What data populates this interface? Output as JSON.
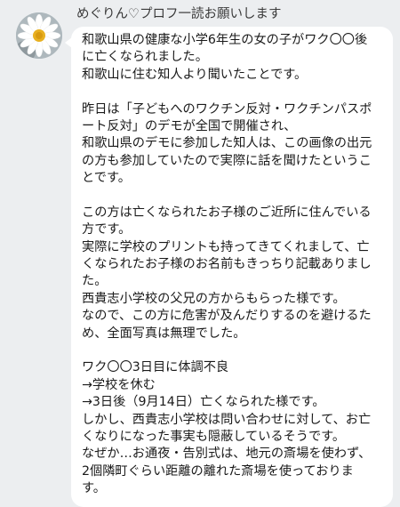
{
  "chat": {
    "sender_name": "めぐりん♡プロフ一読お願いします",
    "avatar_icon": "daisy-flower-avatar",
    "message_lines": [
      "和歌山県の健康な小学6年生の女の子がワク〇〇後",
      "に亡くなられました。",
      "和歌山に住む知人より聞いたことです。",
      "",
      "昨日は「子どもへのワクチン反対・ワクチンパスポ",
      "ート反対」のデモが全国で開催され、",
      "和歌山県のデモに参加した知人は、この画像の出元",
      "の方も参加していたので実際に話を聞けたというこ",
      "とです。",
      "",
      "この方は亡くなられたお子様のご近所に住んでいる",
      "方です。",
      "実際に学校のプリントも持ってきてくれまして、亡",
      "くなられたお子様のお名前もきっちり記載ありまし",
      "た。",
      "西貴志小学校の父兄の方からもらった様です。",
      "なので、この方に危害が及んだりするのを避けるた",
      "め、全面写真は無理でした。",
      "",
      "ワク〇〇3日目に体調不良",
      "→学校を休む",
      "→3日後（9月14日）亡くなられた様です。",
      "しかし、西貴志小学校は問い合わせに対して、お亡",
      "くなりになった事実も隠蔽しているそうです。",
      "なぜか…お通夜・告別式は、地元の斎場を使わず、",
      "2個隣町ぐらい距離の離れた斎場を使っておりま",
      "す。"
    ]
  }
}
